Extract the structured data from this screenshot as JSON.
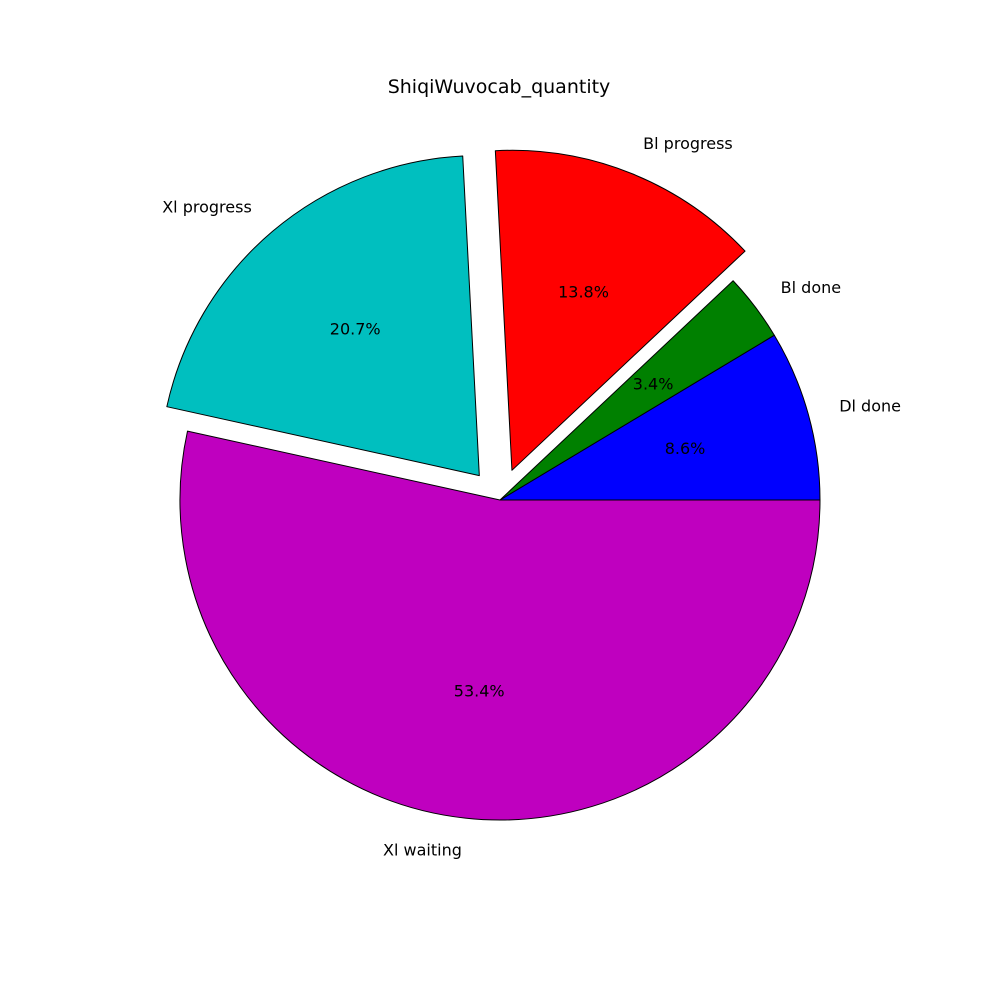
{
  "chart_data": {
    "type": "pie",
    "title": "ShiqiWuvocab_quantity",
    "slices": [
      {
        "label": "Dl done",
        "value": 8.6,
        "pct_label": "8.6%",
        "color": "#0000ff",
        "exploded": false
      },
      {
        "label": "Bl done",
        "value": 3.4,
        "pct_label": "3.4%",
        "color": "#008000",
        "exploded": false
      },
      {
        "label": "Bl progress",
        "value": 13.8,
        "pct_label": "13.8%",
        "color": "#ff0000",
        "exploded": true
      },
      {
        "label": "Xl progress",
        "value": 20.7,
        "pct_label": "20.7%",
        "color": "#00bfbf",
        "exploded": true
      },
      {
        "label": "Xl waiting",
        "value": 53.4,
        "pct_label": "53.4%",
        "color": "#bf00bf",
        "exploded": false
      }
    ],
    "start_angle": 0,
    "direction": "counterclockwise"
  }
}
